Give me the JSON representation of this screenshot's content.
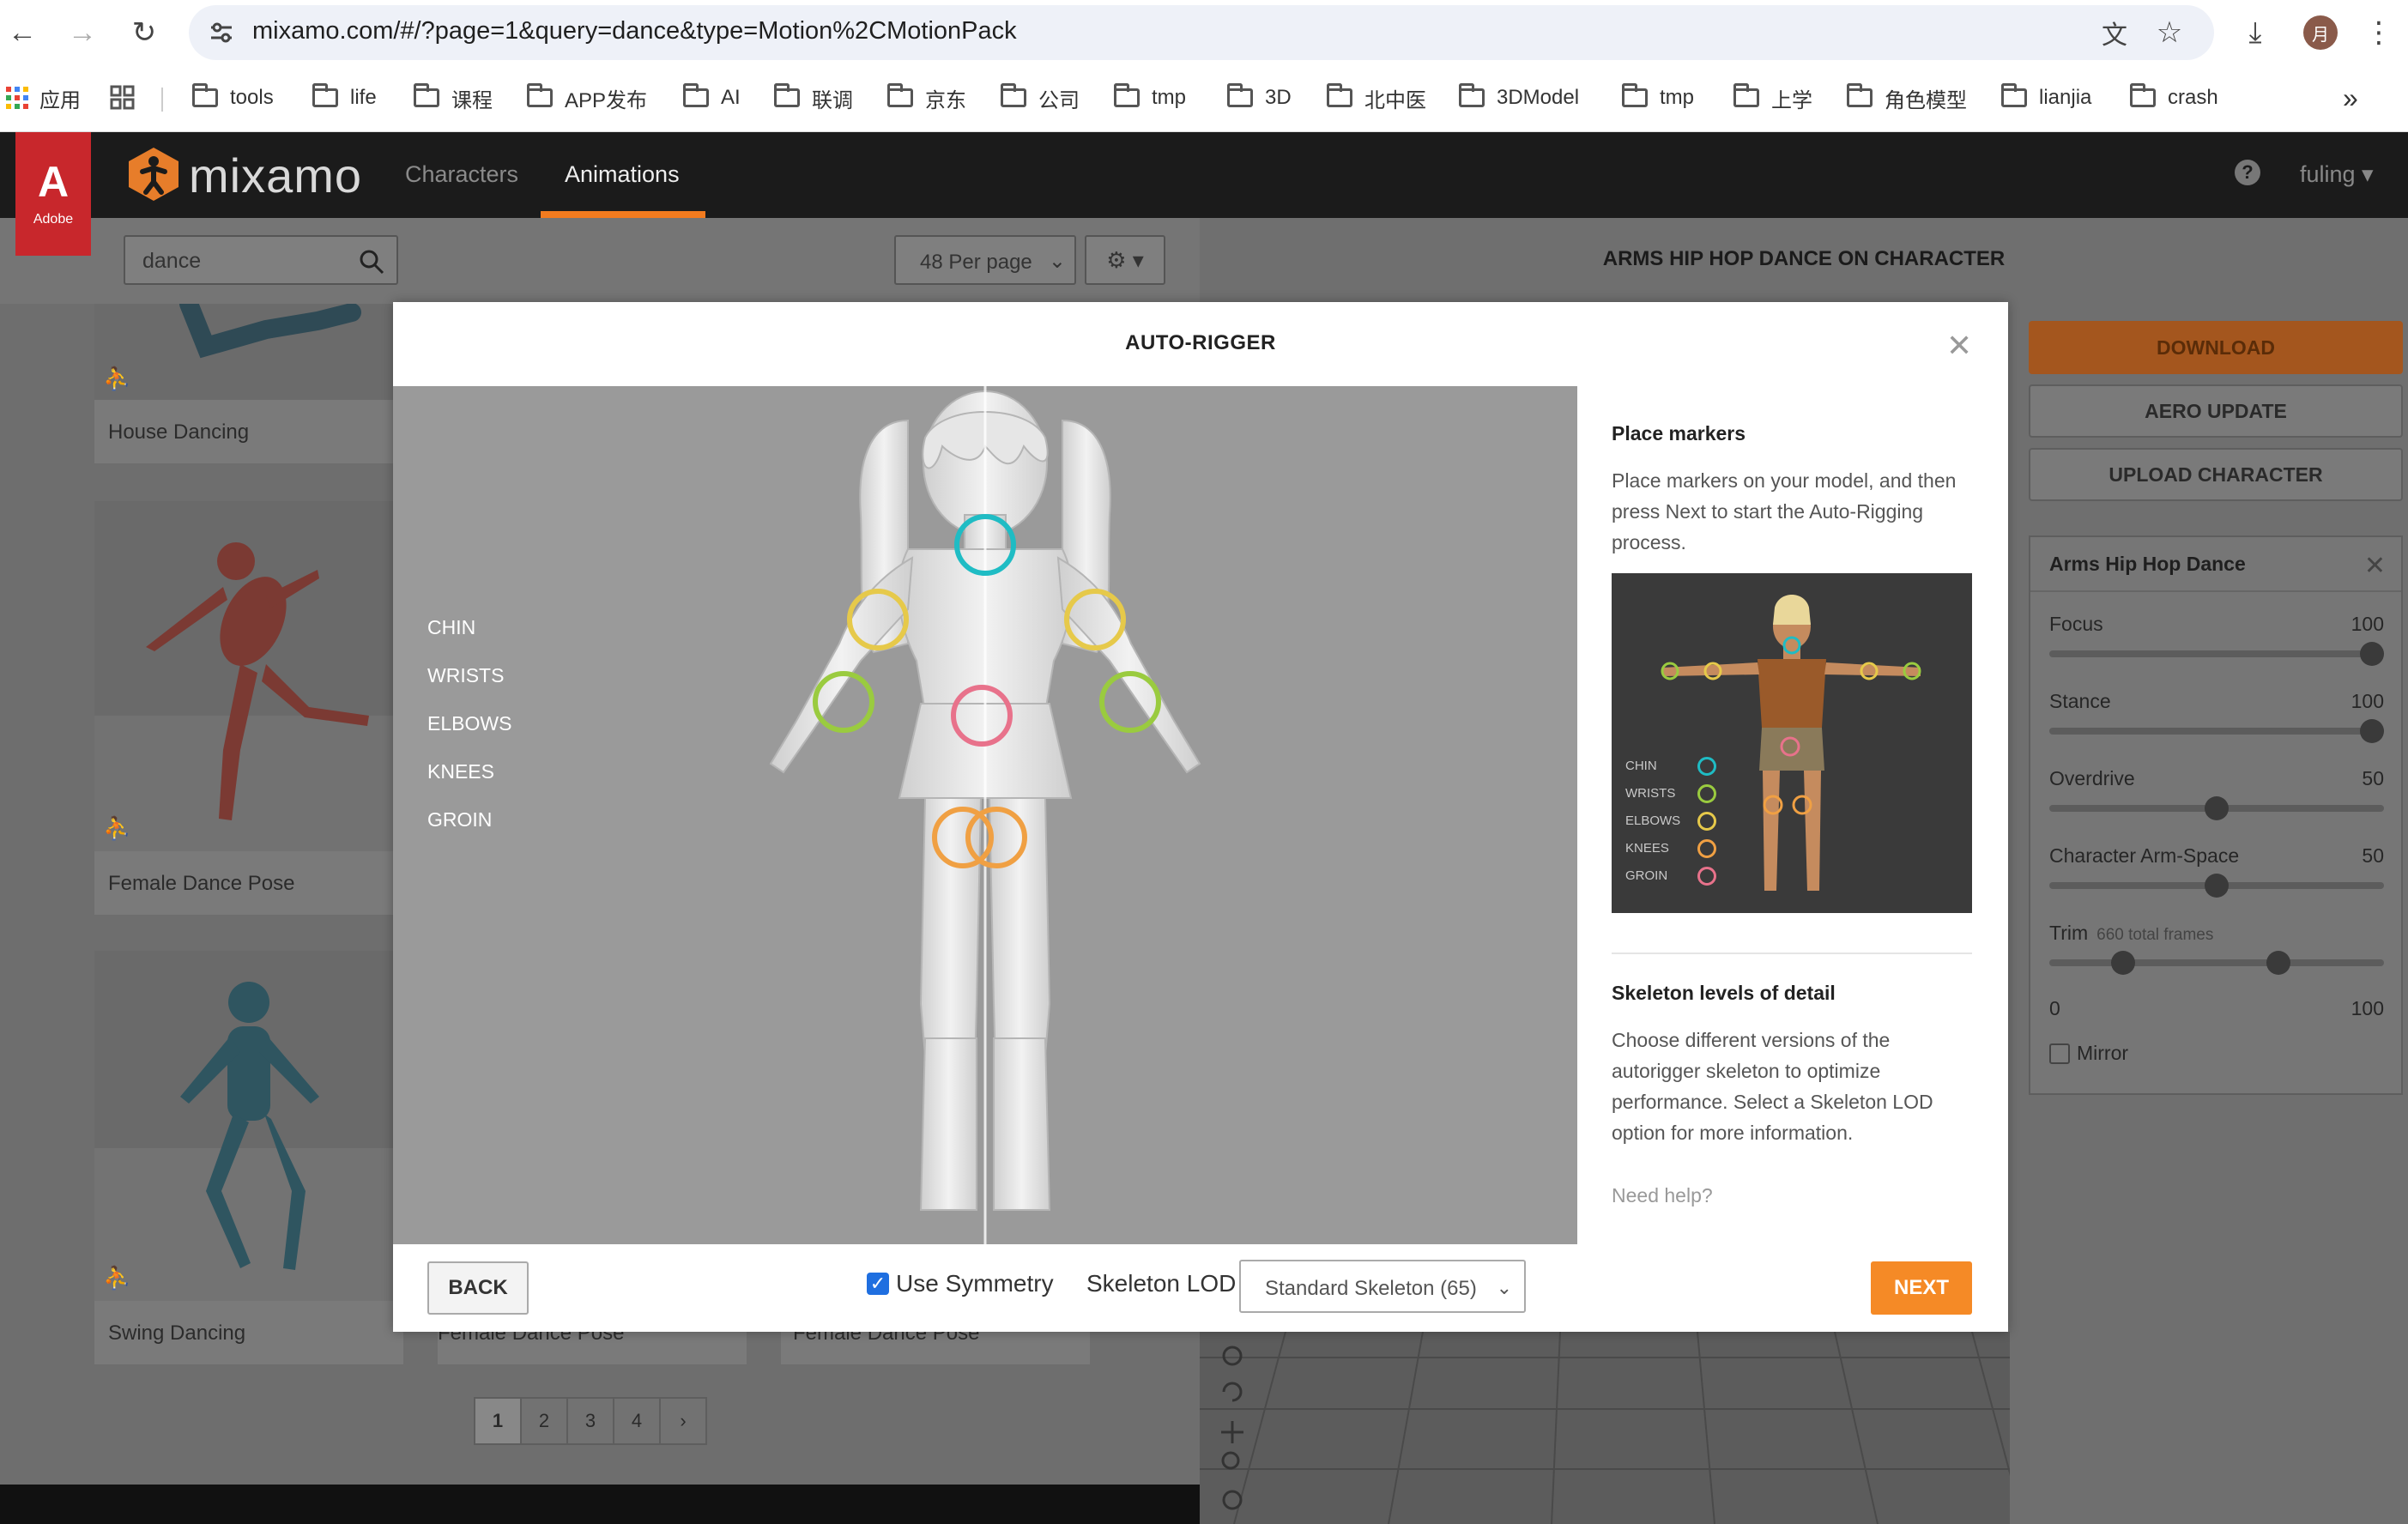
{
  "browser": {
    "url": "mixamo.com/#/?page=1&query=dance&type=Motion%2CMotionPack",
    "avatar_letter": "月",
    "bookmarks": [
      "应用",
      "tools",
      "life",
      "课程",
      "APP发布",
      "AI",
      "联调",
      "京东",
      "公司",
      "tmp",
      "3D",
      "北中医",
      "3DModel",
      "tmp",
      "上学",
      "角色模型",
      "lianjia",
      "crash"
    ],
    "more": "»"
  },
  "app": {
    "adobe_letter": "A",
    "adobe_text": "Adobe",
    "brand": "mixamo",
    "tabs": {
      "characters": "Characters",
      "animations": "Animations"
    },
    "help": "?",
    "user": "fuling ▾",
    "accent_color": "#f58a26"
  },
  "search": {
    "value": "dance",
    "per_page": "48 Per page",
    "gear": "⚙ ▾"
  },
  "cards": {
    "house": "House Dancing",
    "female_pose": "Female Dance Pose",
    "swing": "Swing Dancing",
    "hidden1": "Female Dance Pose",
    "hidden2": "Female Dance Pose"
  },
  "pagination": [
    "1",
    "2",
    "3",
    "4",
    "›"
  ],
  "viewer": {
    "title": "ARMS HIP HOP DANCE ON CHARACTER"
  },
  "actions": {
    "download": "DOWNLOAD",
    "aero": "AERO UPDATE",
    "upload": "UPLOAD CHARACTER"
  },
  "settings": {
    "title": "Arms Hip Hop Dance",
    "close": "✕",
    "focus": {
      "label": "Focus",
      "value": "100",
      "fraction": 1.0
    },
    "stance": {
      "label": "Stance",
      "value": "100",
      "fraction": 1.0
    },
    "overdrive": {
      "label": "Overdrive",
      "value": "50",
      "fraction": 0.5
    },
    "arm_space": {
      "label": "Character Arm-Space",
      "value": "50",
      "fraction": 0.5
    },
    "trim": {
      "label": "Trim",
      "sub": "660 total frames",
      "min": "0",
      "max": "100",
      "start_fraction": 0.2,
      "end_fraction": 0.7
    },
    "mirror": "Mirror"
  },
  "modal": {
    "title": "AUTO-RIGGER",
    "close": "✕",
    "marker_labels": {
      "chin": "CHIN",
      "wrists": "WRISTS",
      "elbows": "ELBOWS",
      "knees": "KNEES",
      "groin": "GROIN"
    },
    "marker_colors": {
      "chin": "#1fbcc4",
      "wrists": "#9acb3f",
      "elbows": "#e6c94a",
      "knees": "#f0a043",
      "groin": "#e8728b"
    },
    "place_title": "Place markers",
    "place_text": "Place markers on your model, and then press Next to start the Auto-Rigging process.",
    "preview_labels": {
      "chin": "CHIN",
      "wrists": "WRISTS",
      "elbows": "ELBOWS",
      "knees": "KNEES",
      "groin": "GROIN"
    },
    "lod_title": "Skeleton levels of detail",
    "lod_text": "Choose different versions of the autorigger skeleton to optimize performance. Select a Skeleton LOD option for more information.",
    "need_help": "Need help?",
    "back": "BACK",
    "use_symmetry": "Use Symmetry",
    "skeleton_lod_label": "Skeleton LOD",
    "skeleton_lod_value": "Standard Skeleton (65)",
    "next": "NEXT"
  }
}
